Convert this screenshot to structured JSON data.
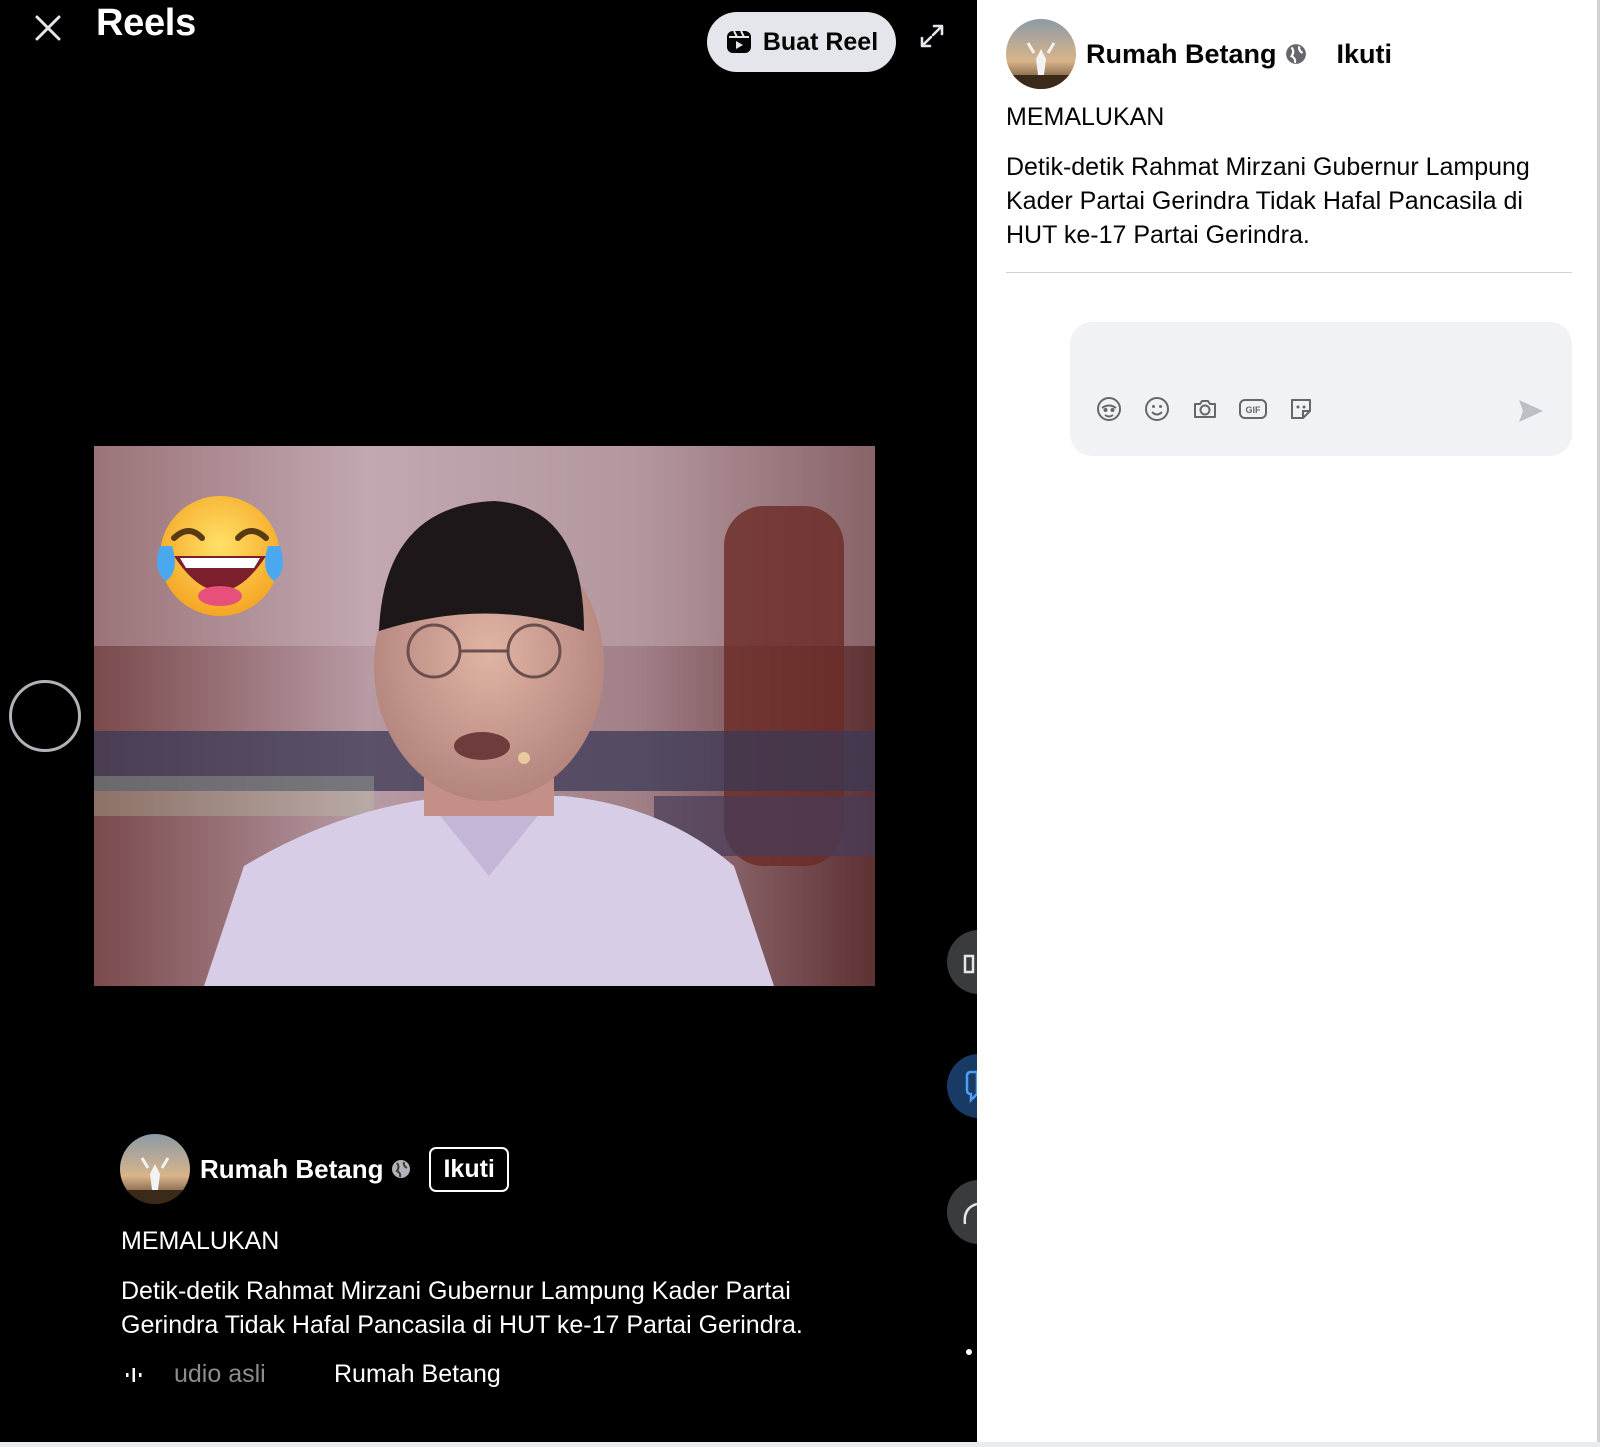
{
  "header": {
    "title": "Reels",
    "create_reel_label": "Buat Reel"
  },
  "post": {
    "author": "Rumah Betang",
    "follow_label": "Ikuti",
    "heading": "MEMALUKAN",
    "body": "Detik-detik Rahmat Mirzani Gubernur Lampung Kader Partai Gerindra Tidak Hafal Pancasila di HUT ke-17 Partai Gerindra.",
    "audio_label": "udio asli",
    "audio_author": "Rumah Betang"
  },
  "comment_box": {
    "placeholder": "",
    "tools": [
      "avatar-sticker-icon",
      "emoji-icon",
      "camera-icon",
      "gif-icon",
      "sticker-icon"
    ],
    "send_icon": "send-icon"
  },
  "colors": {
    "video_bg": "#000000",
    "panel_bg": "#ffffff",
    "button_bg": "#e4e6eb",
    "comment_bg": "#f0f2f5",
    "text_primary": "#050505",
    "text_secondary": "#8a8d91"
  }
}
